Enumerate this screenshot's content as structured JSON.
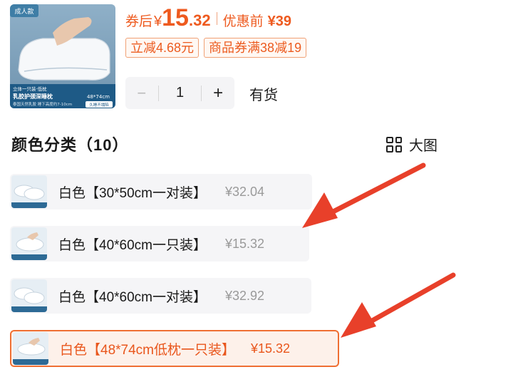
{
  "product": {
    "image_badge": "成人款",
    "image_caption_top": "立体一只装·低枕",
    "image_caption_main": "乳胶护颈深睡枕",
    "image_size": "48*74cm",
    "image_caption_sub": "泰国天然乳胶 睡下高度约7-10cm",
    "image_tag": "久睡不塌陷"
  },
  "price": {
    "after_label": "券后",
    "currency": "¥",
    "after_int": "15",
    "after_dec": ".32",
    "before_label": "优惠前",
    "before_value": "¥39"
  },
  "coupons": [
    "立减4.68元",
    "商品券满38减19"
  ],
  "quantity": {
    "minus": "−",
    "value": "1",
    "plus": "+"
  },
  "stock": "有货",
  "variants": {
    "title": "颜色分类（10）",
    "big_view_label": "大图",
    "items": [
      {
        "name": "白色【30*50cm一对装】",
        "price": "¥32.04"
      },
      {
        "name": "白色【40*60cm一只装】",
        "price": "¥15.32"
      },
      {
        "name": "白色【40*60cm一对装】",
        "price": "¥32.92"
      },
      {
        "name": "白色【48*74cm低枕一只装】",
        "price": "¥15.32"
      }
    ]
  },
  "colors": {
    "accent": "#ee5a1f",
    "arrow": "#e8402a",
    "chip_bg": "#f5f5f7",
    "selected_bg": "#fdf1ea"
  }
}
